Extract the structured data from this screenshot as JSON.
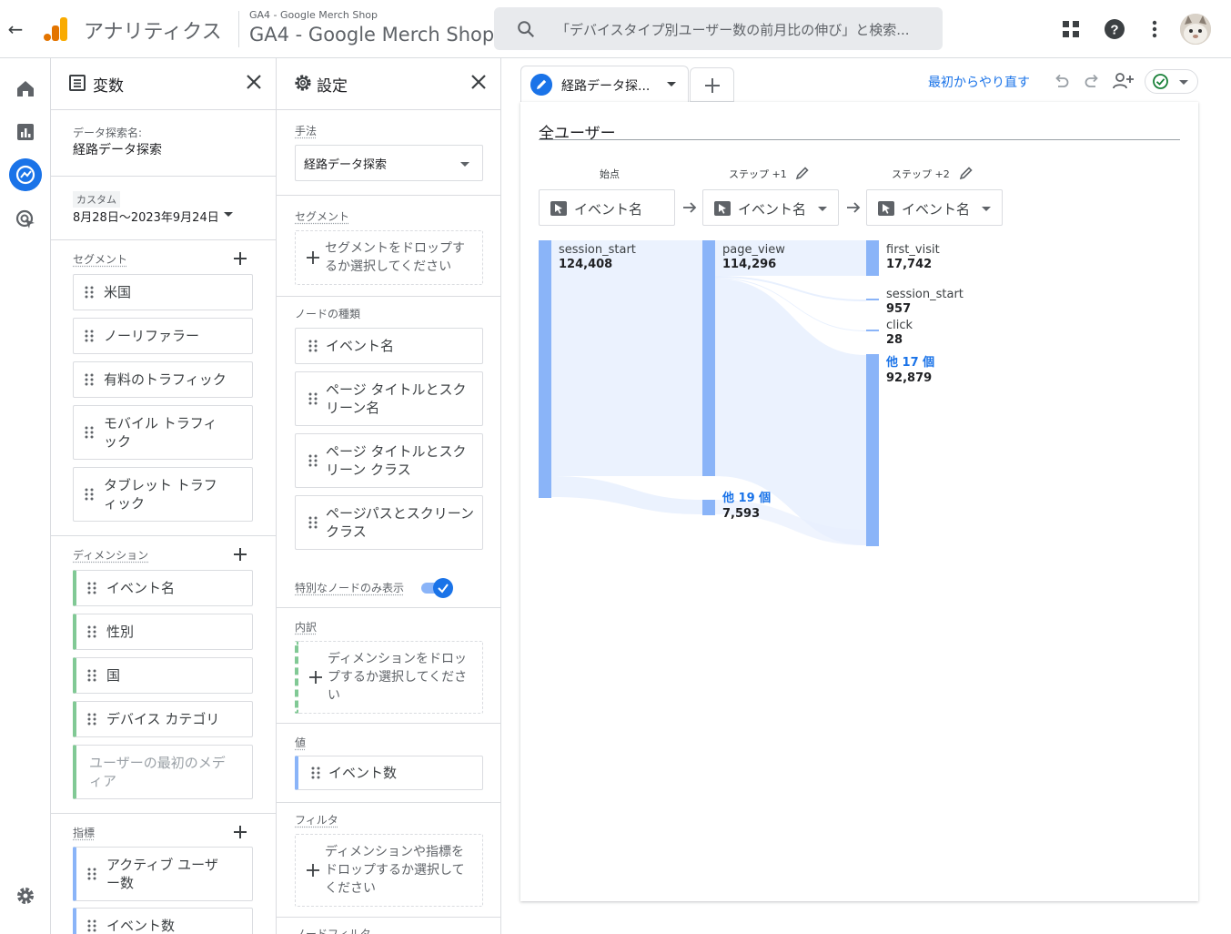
{
  "topbar": {
    "back_icon": "arrow-left-icon",
    "app_name": "アナリティクス",
    "property_small": "GA4 - Google Merch Shop",
    "property_big": "GA4 - Google Merch Shop",
    "search_placeholder": "「デバイスタイプ別ユーザー数の前月比の伸び」と検索...",
    "colors": {
      "accent": "#1a73e8",
      "logo_orange": "#f9ab00",
      "logo_dark": "#e37400"
    }
  },
  "variables": {
    "title": "変数",
    "exploration_name_label": "データ探索名:",
    "exploration_name": "経路データ探索",
    "date_label": "カスタム",
    "date_range": "8月28日～2023年9月24日",
    "segments_label": "セグメント",
    "segments": [
      "米国",
      "ノーリファラー",
      "有料のトラフィック",
      "モバイル トラフィック",
      "タブレット トラフィック"
    ],
    "dimensions_label": "ディメンション",
    "dimensions": [
      "イベント名",
      "性別",
      "国",
      "デバイス カテゴリ",
      "ユーザーの最初のメディア"
    ],
    "metrics_label": "指標",
    "metrics": [
      "アクティブ ユーザー数",
      "イベント数"
    ]
  },
  "settings": {
    "title": "設定",
    "technique_label": "手法",
    "technique_value": "経路データ探索",
    "segment_label": "セグメント",
    "segment_drop": "セグメントをドロップするか選択してください",
    "node_type_label": "ノードの種類",
    "node_types": [
      "イベント名",
      "ページ タイトルとスクリーン名",
      "ページ タイトルとスクリーン クラス",
      "ページパスとスクリーン クラス"
    ],
    "special_nodes_label": "特別なノードのみ表示",
    "special_nodes_on": true,
    "breakdown_label": "内訳",
    "breakdown_drop": "ディメンションをドロップするか選択してください",
    "values_label": "値",
    "values_chip": "イベント数",
    "filter_label": "フィルタ",
    "filter_drop": "ディメンションや指標をドロップするか選択してください",
    "node_filter_label": "ノードフィルタ"
  },
  "workspace": {
    "tab_title": "経路データ探...",
    "restart_label": "最初からやり直す",
    "segment_title": "全ユーザー",
    "steps": [
      {
        "name": "始点",
        "selector": "イベント名",
        "editable": false,
        "dropdown": false
      },
      {
        "name": "ステップ +1",
        "selector": "イベント名",
        "editable": true,
        "dropdown": true
      },
      {
        "name": "ステップ +2",
        "selector": "イベント名",
        "editable": true,
        "dropdown": true
      }
    ],
    "nodes": {
      "start": {
        "label": "session_start",
        "value": "124,408"
      },
      "step1_main": {
        "label": "page_view",
        "value": "114,296"
      },
      "step1_other": {
        "label": "他 19 個",
        "value": "7,593"
      },
      "step2_first_visit": {
        "label": "first_visit",
        "value": "17,742"
      },
      "step2_session_start": {
        "label": "session_start",
        "value": "957"
      },
      "step2_click": {
        "label": "click",
        "value": "28"
      },
      "step2_other": {
        "label": "他 17 個",
        "value": "92,879"
      }
    },
    "colors": {
      "node": "#8ab4f8",
      "flow": "#e8f0fe"
    }
  }
}
